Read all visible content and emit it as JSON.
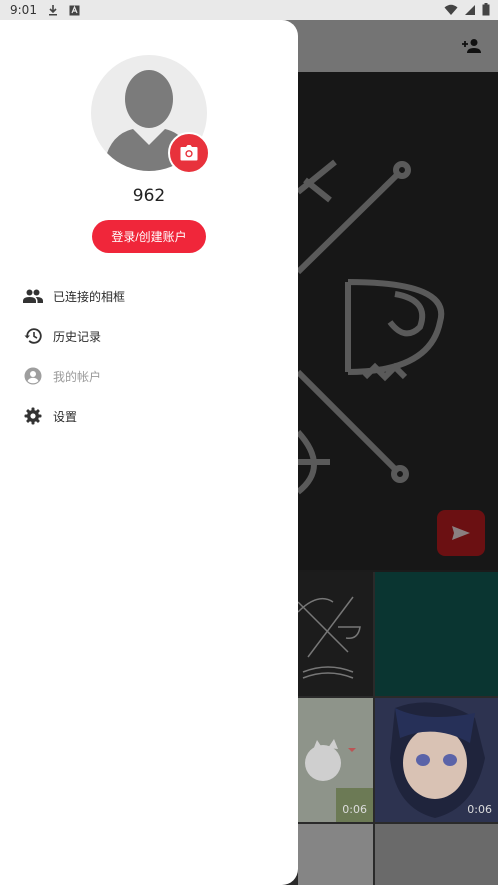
{
  "status_bar": {
    "time": "9:01",
    "left_icons": [
      "download-icon",
      "a-notification-icon"
    ],
    "right_icons": [
      "wifi-icon",
      "signal-icon",
      "battery-icon"
    ]
  },
  "drawer": {
    "username": "962",
    "login_button": "登录/创建账户",
    "menu": [
      {
        "label": "已连接的相框",
        "icon": "people-icon",
        "enabled": true
      },
      {
        "label": "历史记录",
        "icon": "history-icon",
        "enabled": true
      },
      {
        "label": "我的帐户",
        "icon": "account-icon",
        "enabled": false
      },
      {
        "label": "设置",
        "icon": "gear-icon",
        "enabled": true
      }
    ]
  },
  "background_app": {
    "durations": [
      "0:06",
      "0:06"
    ]
  },
  "colors": {
    "accent": "#f0263a",
    "drawer_bg": "#ffffff",
    "scrim": "#3a3a3a"
  }
}
